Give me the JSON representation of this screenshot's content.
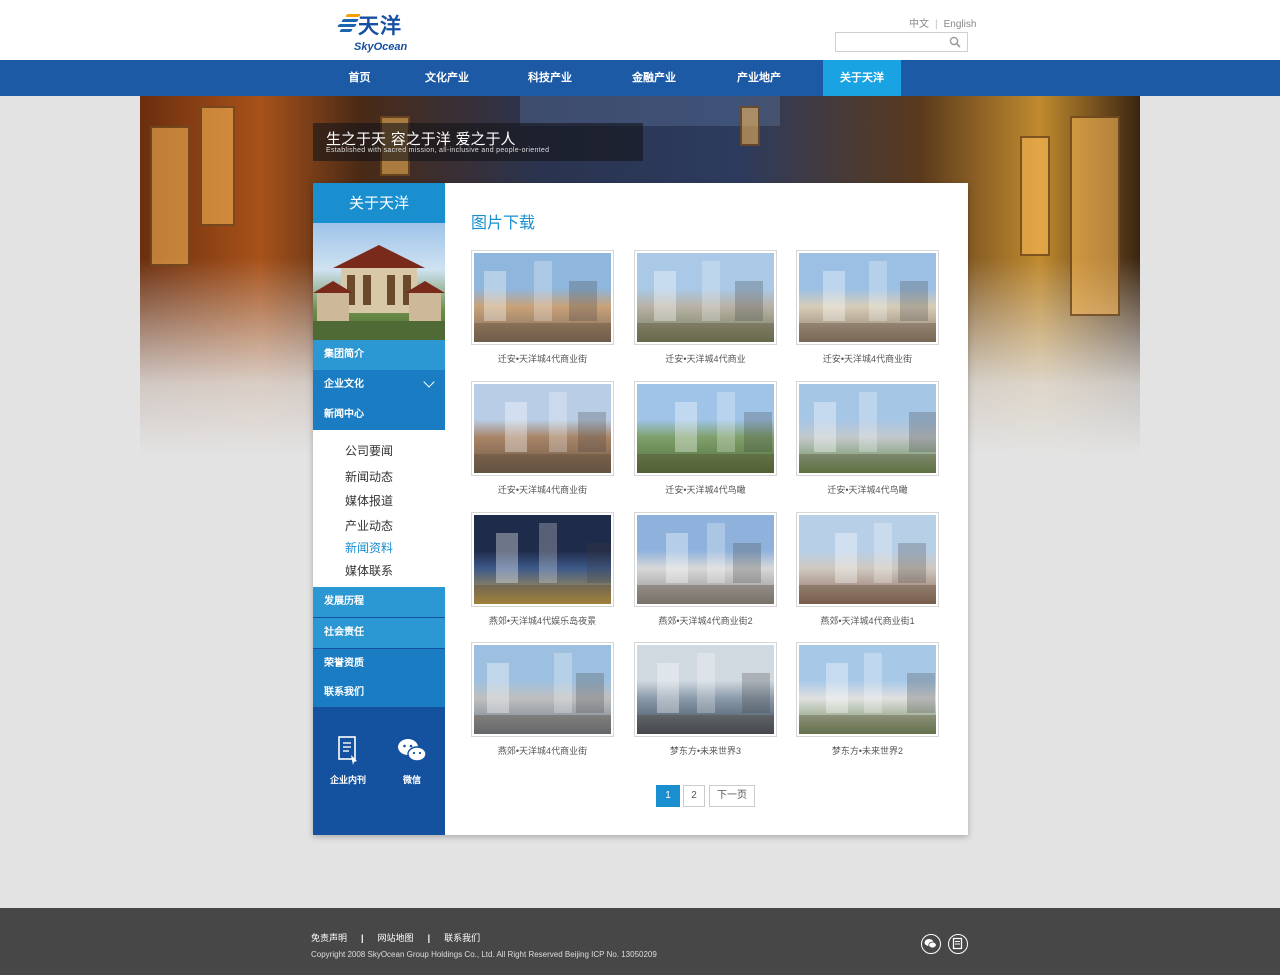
{
  "header": {
    "logo_cn": "天洋",
    "logo_en": "SkyOcean",
    "lang_cn": "中文",
    "lang_sep": "|",
    "lang_en": "English",
    "search_placeholder": ""
  },
  "nav": {
    "items": [
      "首页",
      "文化产业",
      "科技产业",
      "金融产业",
      "产业地产",
      "关于天洋"
    ],
    "active_index": 5
  },
  "banner": {
    "slogan_cn": "生之于天 容之于洋 爱之于人",
    "slogan_en": "Established with sacred mission, all-inclusive and people-oriented"
  },
  "sidebar": {
    "title": "关于天洋",
    "items": [
      "集团简介",
      "企业文化",
      "新闻中心",
      "发展历程",
      "社会责任",
      "荣誉资质",
      "联系我们"
    ],
    "sub_items": [
      "公司要闻",
      "新闻动态",
      "媒体报道",
      "产业动态",
      "新闻资料",
      "媒体联系"
    ],
    "active_sub_index": 4,
    "bottom": {
      "journal": "企业内刊",
      "wechat": "微信"
    }
  },
  "main": {
    "title": "图片下载",
    "gallery": [
      {
        "caption": "迁安•天洋城4代商业街"
      },
      {
        "caption": "迁安•天洋城4代商业"
      },
      {
        "caption": "迁安•天洋城4代商业街"
      },
      {
        "caption": "迁安•天洋城4代商业街"
      },
      {
        "caption": "迁安•天洋城4代鸟瞰"
      },
      {
        "caption": "迁安•天洋城4代鸟瞰"
      },
      {
        "caption": "燕郊•天洋城4代娱乐岛夜景"
      },
      {
        "caption": "燕郊•天洋城4代商业街2"
      },
      {
        "caption": "燕郊•天洋城4代商业街1"
      },
      {
        "caption": "燕郊•天洋城4代商业街"
      },
      {
        "caption": "梦东方•未来世界3"
      },
      {
        "caption": "梦东方•未来世界2"
      }
    ],
    "pagination": {
      "pages": [
        "1",
        "2"
      ],
      "next": "下一页",
      "current": "1"
    }
  },
  "footer": {
    "links": [
      "免责声明",
      "网站地图",
      "联系我们"
    ],
    "copyright": "Copyright 2008 SkyOcean Group Holdings Co., Ltd. All Right Reserved Beijing ICP No. 13050209"
  },
  "colors": {
    "nav_bg": "#1c5aa6",
    "nav_active": "#1aa3e3",
    "accent": "#1a8fd0",
    "footer_bg": "#474747"
  }
}
